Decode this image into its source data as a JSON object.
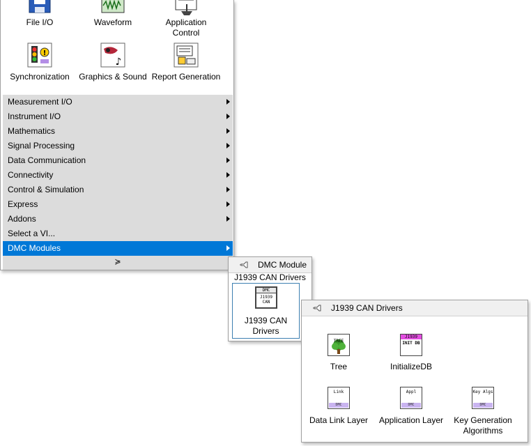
{
  "functions_palette": {
    "icons": [
      {
        "label": "File I/O",
        "icon": "floppy-disk-icon"
      },
      {
        "label": "Waveform",
        "icon": "waveform-icon"
      },
      {
        "label": "Application Control",
        "icon": "application-control-icon"
      },
      {
        "label": "Synchronization",
        "icon": "traffic-light-icon"
      },
      {
        "label": "Graphics & Sound",
        "icon": "graphics-sound-icon"
      },
      {
        "label": "Report Generation",
        "icon": "report-icon"
      }
    ],
    "menu": [
      {
        "label": "Measurement I/O"
      },
      {
        "label": "Instrument I/O"
      },
      {
        "label": "Mathematics"
      },
      {
        "label": "Signal Processing"
      },
      {
        "label": "Data Communication"
      },
      {
        "label": "Connectivity"
      },
      {
        "label": "Control & Simulation"
      },
      {
        "label": "Express"
      },
      {
        "label": "Addons"
      },
      {
        "label": "Select a VI..."
      },
      {
        "label": "DMC Modules"
      }
    ],
    "expand_glyph": "≽"
  },
  "dmc_palette": {
    "title": "DMC Module",
    "subtitle": "J1939 CAN Drivers",
    "item": {
      "label": "J1939 CAN Drivers",
      "icon_tag": "DMC",
      "icon_text": "J1939 CAN"
    }
  },
  "j1939_palette": {
    "title": "J1939 CAN Drivers",
    "items": [
      {
        "label": "Tree",
        "icon_text": "TREE"
      },
      {
        "label": "InitializeDB",
        "icon_text": "INIT DB",
        "icon_tag": "J1939"
      },
      {
        "label": "Data Link Layer",
        "icon_text": "Link",
        "icon_tag": "DMC"
      },
      {
        "label": "Application Layer",
        "icon_text": "Appl",
        "icon_tag": "DMC"
      },
      {
        "label": "Key Generation Algorithms",
        "icon_text": "Key Algs",
        "icon_tag": "DMC"
      }
    ]
  },
  "colors": {
    "selection": "#0078d7",
    "menu_bg": "#dcdcdc",
    "dmc_strip": "#c9b4f0",
    "header_bg": "#f0f0f0"
  }
}
